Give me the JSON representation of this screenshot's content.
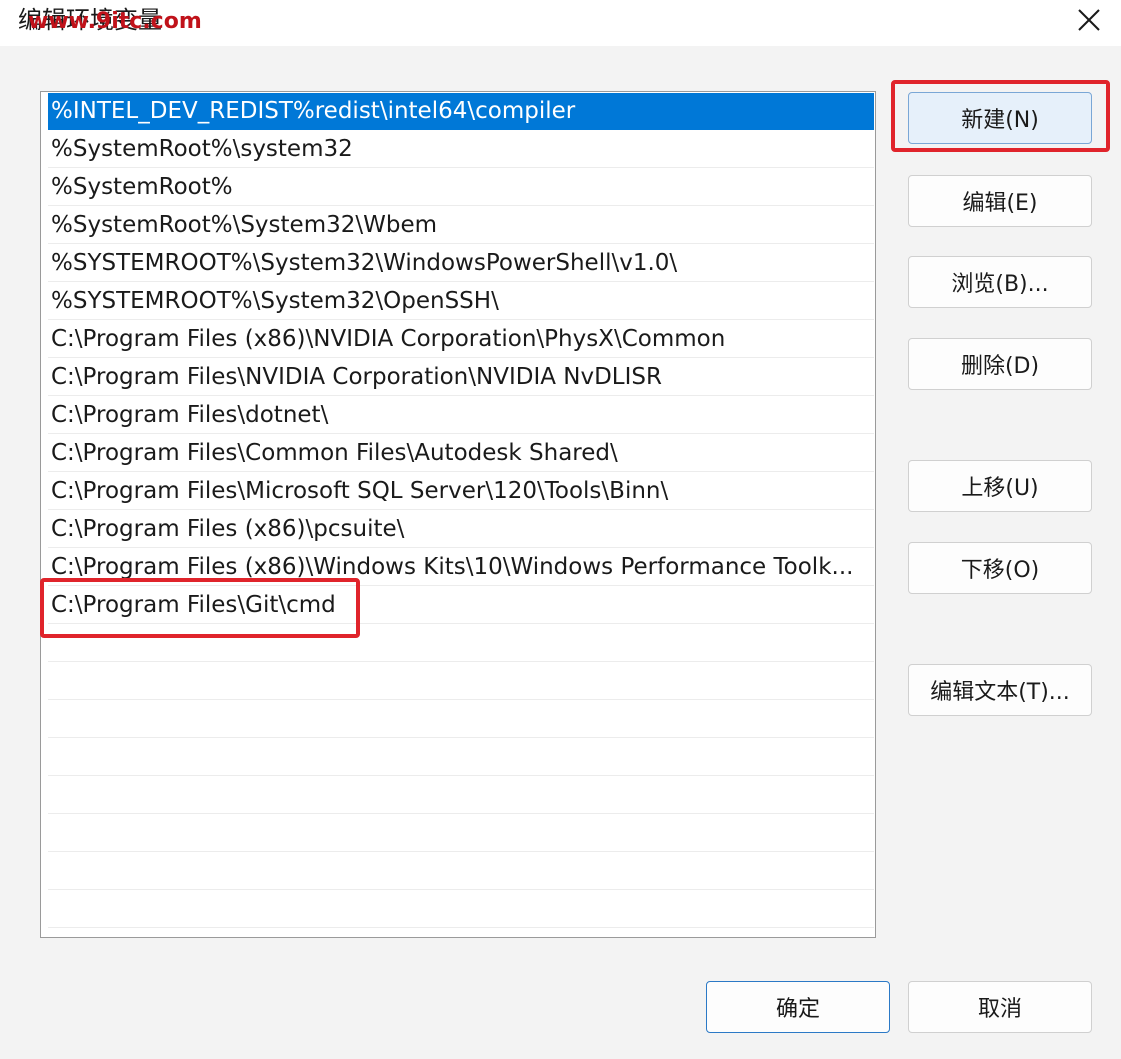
{
  "window": {
    "title": "编辑环境变量",
    "watermark": "www.9itc.com"
  },
  "path_list": {
    "items": [
      "%INTEL_DEV_REDIST%redist\\intel64\\compiler",
      "%SystemRoot%\\system32",
      "%SystemRoot%",
      "%SystemRoot%\\System32\\Wbem",
      "%SYSTEMROOT%\\System32\\WindowsPowerShell\\v1.0\\",
      "%SYSTEMROOT%\\System32\\OpenSSH\\",
      "C:\\Program Files (x86)\\NVIDIA Corporation\\PhysX\\Common",
      "C:\\Program Files\\NVIDIA Corporation\\NVIDIA NvDLISR",
      "C:\\Program Files\\dotnet\\",
      "C:\\Program Files\\Common Files\\Autodesk Shared\\",
      "C:\\Program Files\\Microsoft SQL Server\\120\\Tools\\Binn\\",
      "C:\\Program Files (x86)\\pcsuite\\",
      "C:\\Program Files (x86)\\Windows Kits\\10\\Windows Performance Toolk...",
      "C:\\Program Files\\Git\\cmd"
    ],
    "selected_index": 0
  },
  "buttons": {
    "new": "新建(N)",
    "edit": "编辑(E)",
    "browse": "浏览(B)...",
    "delete": "删除(D)",
    "move_up": "上移(U)",
    "move_down": "下移(O)",
    "edit_text": "编辑文本(T)...",
    "ok": "确定",
    "cancel": "取消"
  },
  "colors": {
    "selection": "#0078d7",
    "highlight_box": "#e0242b",
    "watermark": "#c0121a"
  }
}
